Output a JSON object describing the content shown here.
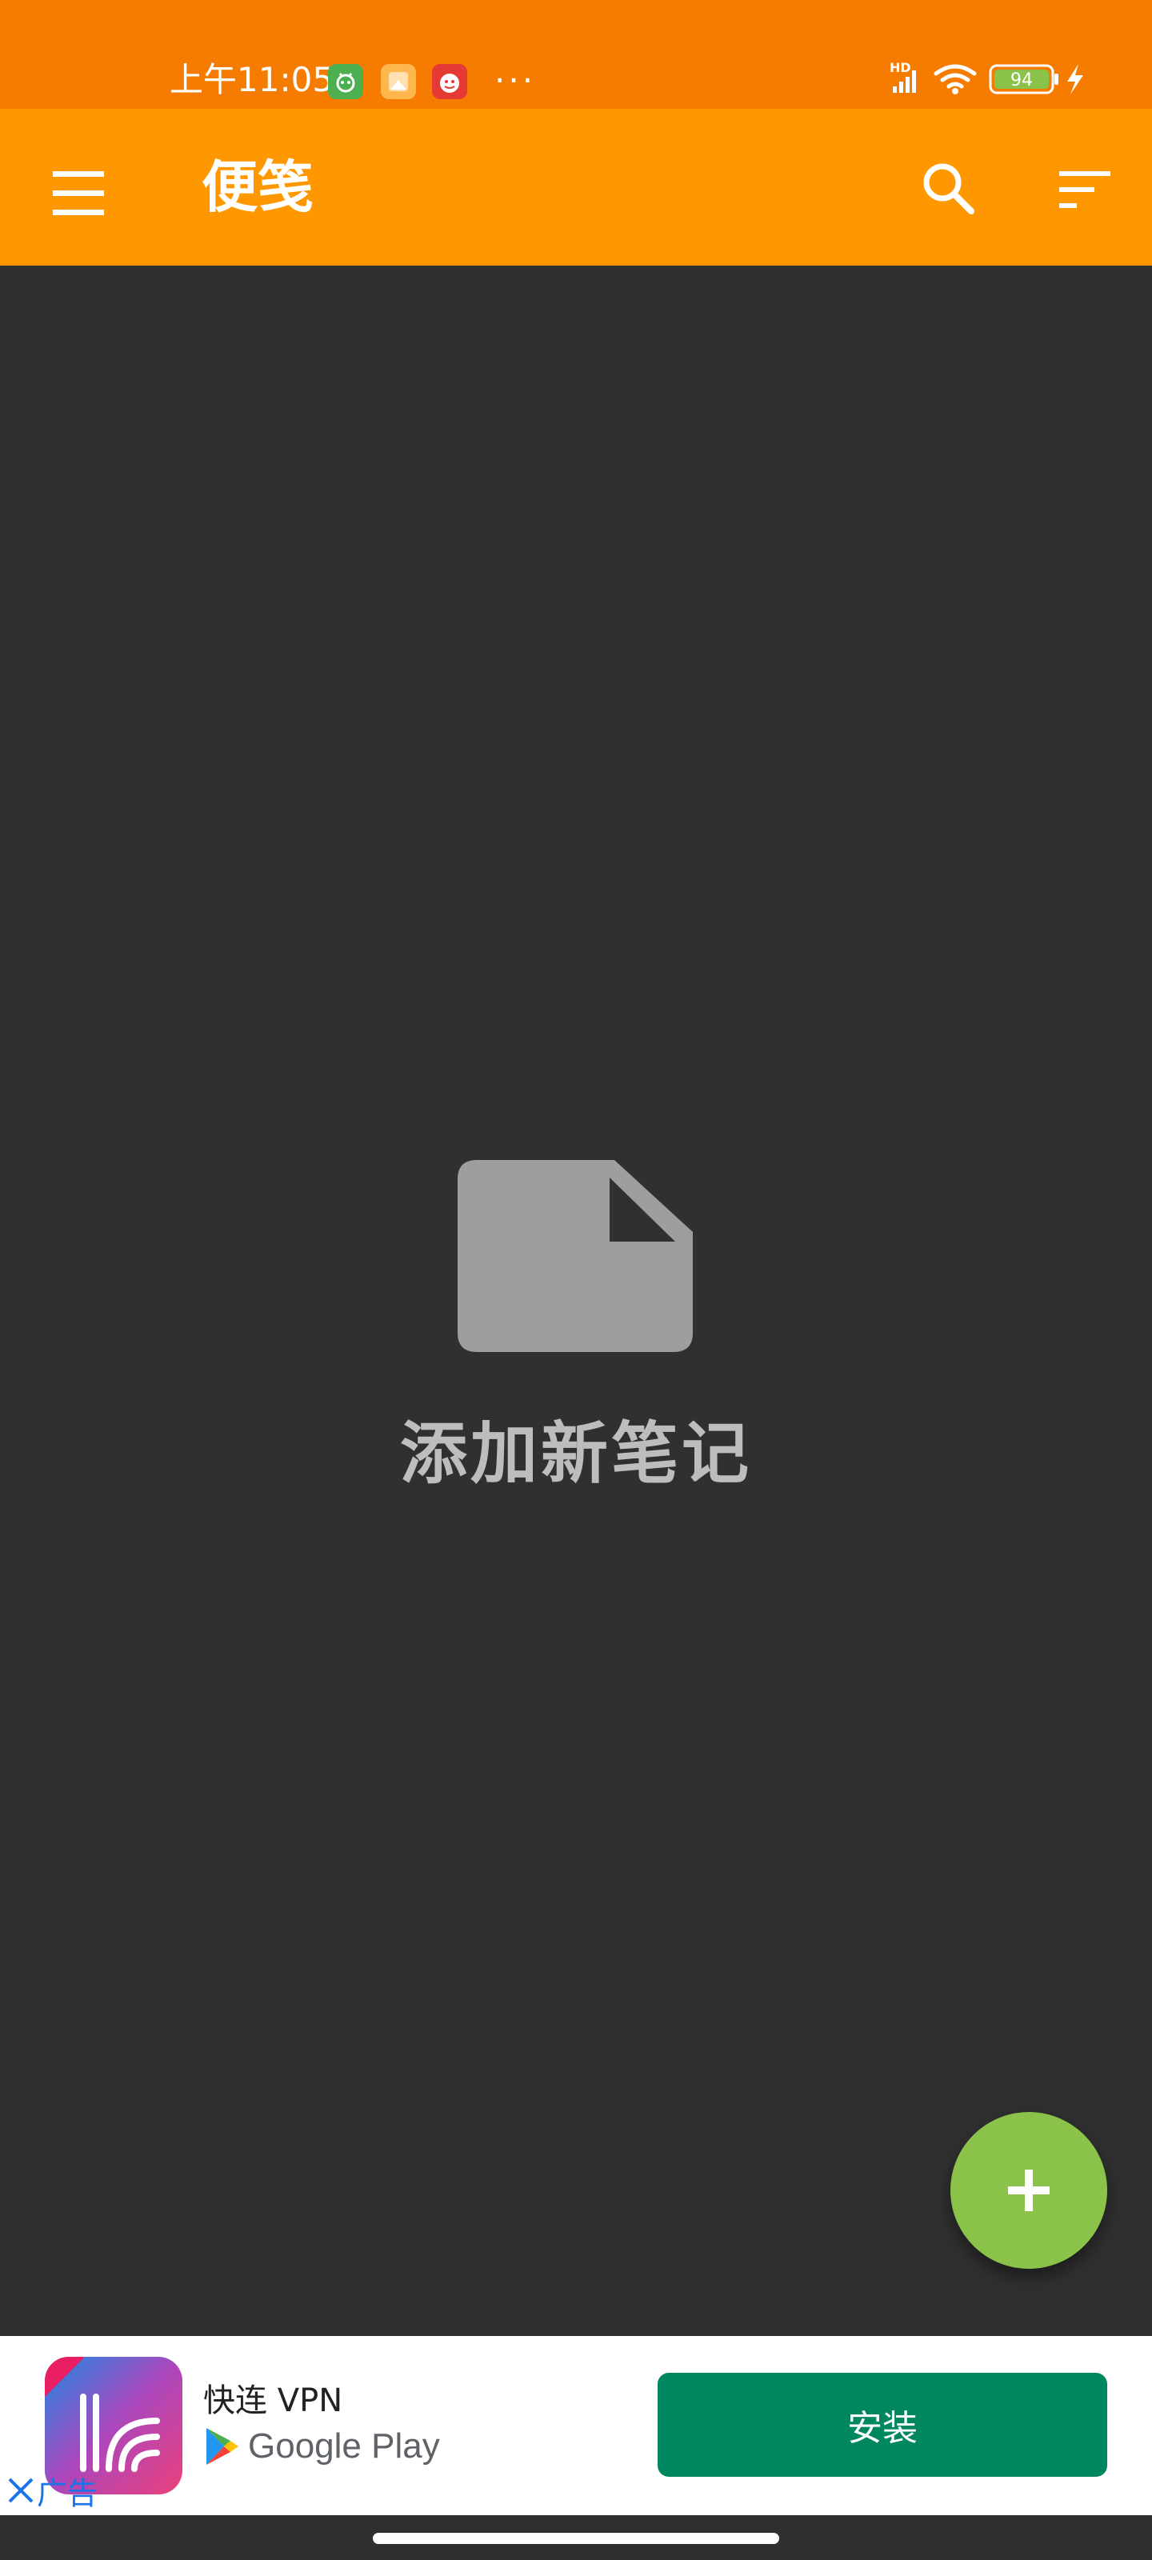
{
  "status_bar": {
    "time": "上午11:05",
    "more": "···",
    "battery": "94",
    "network_label": "HD",
    "icons": [
      "android-icon",
      "gallery-icon",
      "app-badge-icon",
      "signal-icon",
      "wifi-icon",
      "battery-icon",
      "charging-icon"
    ]
  },
  "app_bar": {
    "title": "便笺",
    "menu_icon": "menu-icon",
    "search_icon": "search-icon",
    "sort_icon": "sort-icon"
  },
  "empty_state": {
    "icon": "note-icon",
    "text": "添加新笔记"
  },
  "fab": {
    "icon": "plus-icon"
  },
  "ad": {
    "app_name": "快连 VPN",
    "store_label": "Google Play",
    "install_label": "安装",
    "close_label": "广告",
    "close_icon": "close-icon"
  },
  "colors": {
    "status_bar": "#F57C00",
    "app_bar": "#FF9800",
    "background": "#303030",
    "fab": "#8BC34A",
    "install": "#01875F"
  }
}
